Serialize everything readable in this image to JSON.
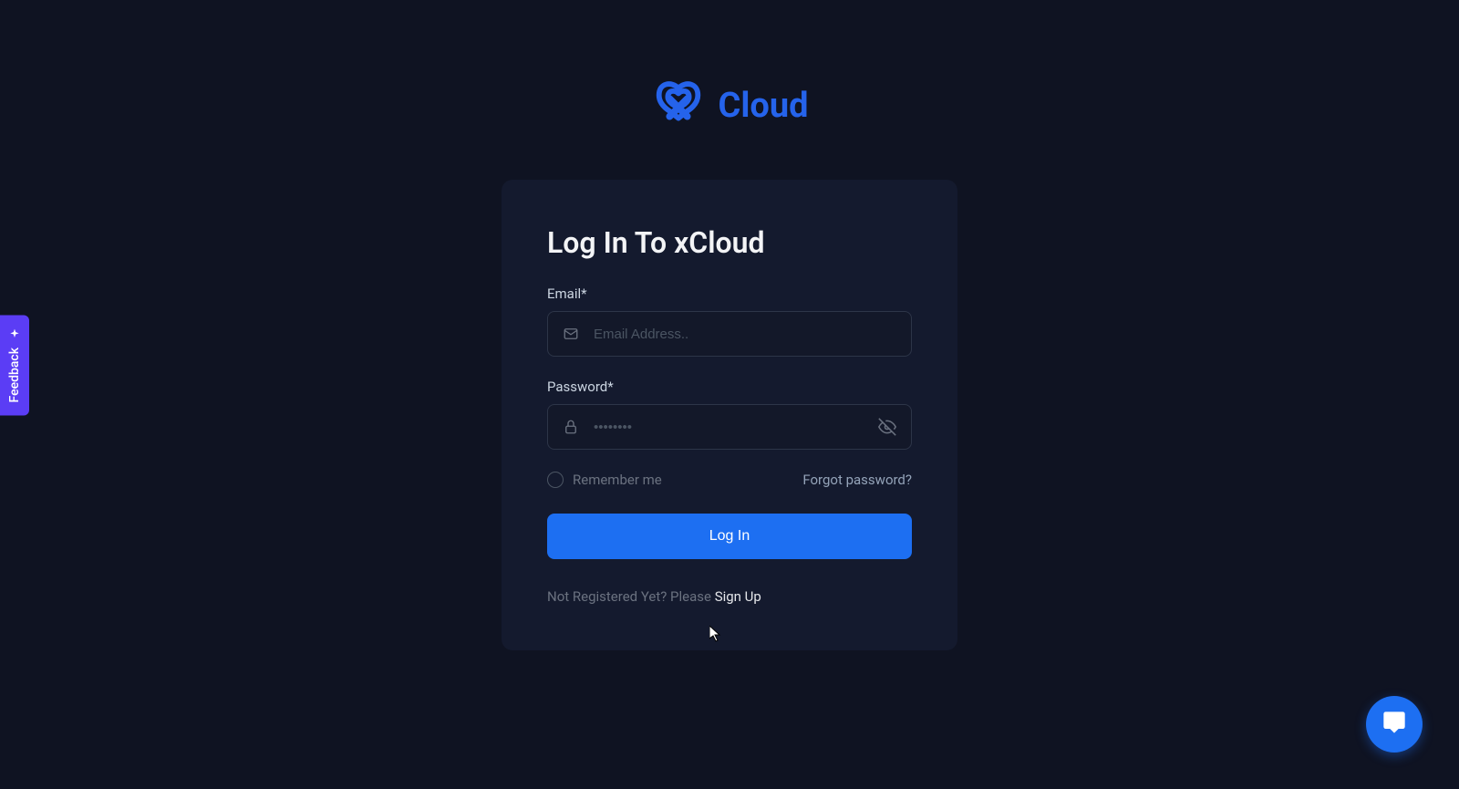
{
  "brand": {
    "name": "Cloud"
  },
  "card": {
    "title": "Log In To xCloud",
    "email": {
      "label": "Email*",
      "placeholder": "Email Address..",
      "value": ""
    },
    "password": {
      "label": "Password*",
      "placeholder": "••••••••",
      "value": ""
    },
    "remember_label": "Remember me",
    "forgot_label": "Forgot password?",
    "login_button": "Log In",
    "signup_prefix": "Not Registered Yet? Please ",
    "signup_link": "Sign Up"
  },
  "feedback": {
    "label": "Feedback"
  }
}
